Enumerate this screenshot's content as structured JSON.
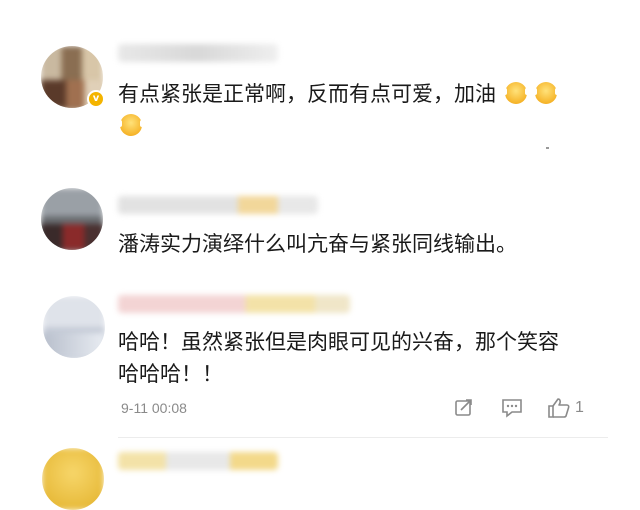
{
  "comments": [
    {
      "text": "有点紧张是正常啊，反而有点可爱，加油",
      "emojis": [
        "laughing-cry-emoji",
        "laughing-cry-emoji",
        "laughing-cry-emoji"
      ]
    },
    {
      "text": "潘涛实力演绎什么叫亢奋与紧张同线输出。"
    },
    {
      "text_line1": "哈哈！虽然紧张但是肉眼可见的兴奋，那个笑容",
      "text_line2": "哈哈哈！！",
      "timestamp": "9-11 00:08",
      "like_count": "1",
      "icons": {
        "share": "share-icon",
        "reply": "comment-icon",
        "like": "thumbs-up-icon"
      }
    }
  ],
  "colors": {
    "text": "#1a1a1a",
    "meta": "#8a8a8a",
    "verified": "#f4b400"
  }
}
